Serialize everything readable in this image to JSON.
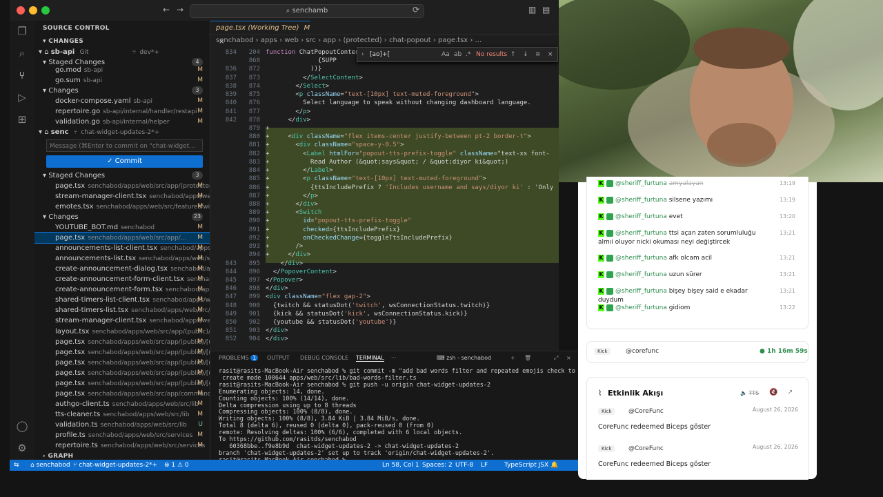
{
  "window": {
    "search": "senchamb"
  },
  "sidebar": {
    "title": "SOURCE CONTROL",
    "changes_header": "CHANGES",
    "repo1": {
      "name": "sb-api",
      "kind": "Git",
      "branch": "dev*+"
    },
    "staged1": {
      "label": "Staged Changes",
      "count": "4"
    },
    "staged1_items": [
      {
        "name": "go.mod",
        "path": "sb-api",
        "status": "M"
      },
      {
        "name": "go.sum",
        "path": "sb-api",
        "status": "M"
      }
    ],
    "changes1": {
      "label": "Changes",
      "count": "3"
    },
    "changes1_items": [
      {
        "name": "docker-compose.yaml",
        "path": "sb-api",
        "status": "M"
      },
      {
        "name": "repertoire.go",
        "path": "sb-api/internal/handler/restapi",
        "status": "M"
      },
      {
        "name": "validation.go",
        "path": "sb-api/internal/helper",
        "status": "M"
      }
    ],
    "repo2": {
      "name": "senc",
      "branch": "chat-widget-updates-2*+"
    },
    "message_placeholder": "Message (⌘Enter to commit on \"chat-widget...",
    "commit_label": "Commit",
    "staged2": {
      "label": "Staged Changes",
      "count": "3"
    },
    "staged2_items": [
      {
        "name": "page.tsx",
        "path": "senchabod/apps/web/src/app/(protected)...",
        "status": "M"
      },
      {
        "name": "stream-manager-client.tsx",
        "path": "senchabod/apps/web...",
        "status": "M"
      },
      {
        "name": "emotes.tsx",
        "path": "senchabod/apps/web/src/features/wid...",
        "status": "M"
      }
    ],
    "changes2": {
      "label": "Changes",
      "count": "23"
    },
    "changes2_items": [
      {
        "name": "YOUTUBE_BOT.md",
        "path": "senchabod",
        "status": "M"
      },
      {
        "name": "page.tsx",
        "path": "senchabod/apps/web/src/app/...",
        "status": "M"
      },
      {
        "name": "announcements-list-client.tsx",
        "path": "senchabod/apps/...",
        "status": "M"
      },
      {
        "name": "announcements-list.tsx",
        "path": "senchabod/apps/web/src...",
        "status": "M"
      },
      {
        "name": "create-announcement-dialog.tsx",
        "path": "senchabod/app...",
        "status": "M"
      },
      {
        "name": "create-announcement-form-client.tsx",
        "path": "senchab...",
        "status": "M"
      },
      {
        "name": "create-announcement-form.tsx",
        "path": "senchabod/apps...",
        "status": "M"
      },
      {
        "name": "shared-timers-list-client.tsx",
        "path": "senchabod/apps/we...",
        "status": "M"
      },
      {
        "name": "shared-timers-list.tsx",
        "path": "senchabod/apps/web/src/a...",
        "status": "M"
      },
      {
        "name": "stream-manager-client.tsx",
        "path": "senchabod/apps/web/sr...",
        "status": "M"
      },
      {
        "name": "layout.tsx",
        "path": "senchabod/apps/web/src/app/(public)/[...",
        "status": "M"
      },
      {
        "name": "page.tsx",
        "path": "senchabod/apps/web/src/app/(public)/[u...",
        "status": "M"
      },
      {
        "name": "page.tsx",
        "path": "senchabod/apps/web/src/app/(public)/[u...",
        "status": "M"
      },
      {
        "name": "page.tsx",
        "path": "senchabod/apps/web/src/app/(public)/[u...",
        "status": "M"
      },
      {
        "name": "page.tsx",
        "path": "senchabod/apps/web/src/app/(public)/[u...",
        "status": "M"
      },
      {
        "name": "page.tsx",
        "path": "senchabod/apps/web/src/app/(public)/[u...",
        "status": "M"
      },
      {
        "name": "page.tsx",
        "path": "senchabod/apps/web/src/app/commands...",
        "status": "M"
      },
      {
        "name": "authgo-client.ts",
        "path": "senchabod/apps/web/src/lib",
        "status": "M"
      },
      {
        "name": "tts-cleaner.ts",
        "path": "senchabod/apps/web/src/lib",
        "status": "M"
      },
      {
        "name": "validation.ts",
        "path": "senchabod/apps/web/src/lib",
        "status": "U"
      },
      {
        "name": "profile.ts",
        "path": "senchabod/apps/web/src/services",
        "status": "M"
      },
      {
        "name": "repertoire.ts",
        "path": "senchabod/apps/web/src/services",
        "status": "M"
      }
    ],
    "graph": "GRAPH"
  },
  "editor": {
    "tab": "page.tsx (Working Tree)",
    "tab_status": "M",
    "breadcrumb": [
      "senchabod",
      "apps",
      "web",
      "src",
      "app",
      "(protected)",
      "chat-popout",
      "page.tsx",
      "..."
    ],
    "find": {
      "query": "[ao]+[",
      "result": "No results"
    },
    "lines": [
      [
        "834",
        "204",
        "function ChatPopoutContent("
      ],
      [
        "",
        "868",
        "              {SUPP"
      ],
      [
        "836",
        "872",
        "            ))}"
      ],
      [
        "837",
        "873",
        "          </SelectContent>"
      ],
      [
        "838",
        "874",
        "        </Select>"
      ],
      [
        "839",
        "875",
        "        <p className=\"text-[10px] text-muted-foreground\">"
      ],
      [
        "840",
        "876",
        "          Select language to speak without changing dashboard language."
      ],
      [
        "841",
        "877",
        "        </p>"
      ],
      [
        "842",
        "878",
        "      </div>"
      ],
      [
        "",
        "879",
        "+"
      ],
      [
        "",
        "880",
        "+     <div className=\"flex items-center justify-between pt-2 border-t\">"
      ],
      [
        "",
        "881",
        "+       <div className=\"space-y-0.5\">"
      ],
      [
        "",
        "882",
        "+         <Label htmlFor=\"popout-tts-prefix-toggle\" className=\"text-xs font-"
      ],
      [
        "",
        "883",
        "+           Read Author (&quot;says&quot; / &quot;diyor ki&quot;)"
      ],
      [
        "",
        "884",
        "+         </Label>"
      ],
      [
        "",
        "885",
        "+         <p className=\"text-[10px] text-muted-foreground\">"
      ],
      [
        "",
        "886",
        "+           {ttsIncludePrefix ? 'Includes username and says/diyor ki' : 'Only"
      ],
      [
        "",
        "887",
        "+         </p>"
      ],
      [
        "",
        "888",
        "+       </div>"
      ],
      [
        "",
        "889",
        "+       <Switch"
      ],
      [
        "",
        "890",
        "+         id=\"popout-tts-prefix-toggle\""
      ],
      [
        "",
        "891",
        "+         checked={ttsIncludePrefix}"
      ],
      [
        "",
        "892",
        "+         onCheckedChange={toggleTtsIncludePrefix}"
      ],
      [
        "",
        "893",
        "+       />"
      ],
      [
        "",
        "894",
        "+     </div>"
      ],
      [
        "843",
        "895",
        "    </div>"
      ],
      [
        "844",
        "896",
        "  </PopoverContent>"
      ],
      [
        "845",
        "897",
        "</Popover>"
      ],
      [
        "846",
        "898",
        "</div>"
      ],
      [
        "847",
        "899",
        "<div className=\"flex gap-2\">"
      ],
      [
        "848",
        "900",
        "  {twitch && statusDot('twitch', wsConnectionStatus.twitch)}"
      ],
      [
        "849",
        "901",
        "  {kick && statusDot('kick', wsConnectionStatus.kick)}"
      ],
      [
        "850",
        "902",
        "  {youtube && statusDot('youtube')}"
      ],
      [
        "851",
        "903",
        "</div>"
      ],
      [
        "852",
        "904",
        "</div>"
      ]
    ]
  },
  "panel": {
    "tabs": [
      "PROBLEMS",
      "OUTPUT",
      "DEBUG CONSOLE",
      "TERMINAL",
      "···"
    ],
    "problems_count": "1",
    "shell": "zsh - senchabod",
    "terminal": [
      "rasit@rasits-MacBook-Air senchabod % git commit -m \"add bad words filter and repeated emojis check to tts\"",
      " create mode 100644 apps/web/src/lib/bad-words-filter.ts",
      "rasit@rasits-MacBook-Air senchabod % git push -u origin chat-widget-updates-2",
      "Enumerating objects: 14, done.",
      "Counting objects: 100% (14/14), done.",
      "Delta compression using up to 8 threads",
      "Compressing objects: 100% (8/8), done.",
      "Writing objects: 100% (8/8), 3.84 KiB | 3.84 MiB/s, done.",
      "Total 8 (delta 6), reused 0 (delta 0), pack-reused 0 (from 0)",
      "remote: Resolving deltas: 100% (6/6), completed with 6 local objects.",
      "To https://github.com/rasitds/senchabod",
      "   60368bbe..f9e8b9d  chat-widget-updates-2 -> chat-widget-updates-2",
      "branch 'chat-widget-updates-2' set up to track 'origin/chat-widget-updates-2'.",
      "rasit@rasits-MacBook-Air senchabod % "
    ]
  },
  "statusbar": {
    "repo": "senchabod",
    "branch": "chat-widget-updates-2*+",
    "problems": "⊗ 1 ⚠ 0",
    "position": "Ln 58, Col 1",
    "spaces": "Spaces: 2",
    "encoding": "UTF-8",
    "eol": "LF",
    "language": "TypeScript JSX"
  },
  "chat": {
    "messages": [
      {
        "user": "@sheriff_furtuna",
        "text": "amyalayan",
        "time": "13:19"
      },
      {
        "user": "@sheriff_furtuna",
        "text": "silsene yazımı",
        "time": "13:19"
      },
      {
        "user": "@sheriff_furtuna",
        "text": "evet",
        "time": "13:20"
      },
      {
        "user": "@sheriff_furtuna",
        "text": "ttsi açan zaten sorumluluğu almıi oluyor nicki okuması neyi değiştircek",
        "time": "13:21"
      },
      {
        "user": "@sheriff_furtuna",
        "text": "afk olcam acil",
        "time": "13:21"
      },
      {
        "user": "@sheriff_furtuna",
        "text": "uzun sürer",
        "time": "13:21"
      },
      {
        "user": "@sheriff_furtuna",
        "text": "bişey bişey said e ekadar duydum",
        "time": "13:21"
      },
      {
        "user": "@sheriff_furtuna",
        "text": "gidiom",
        "time": "13:22"
      }
    ],
    "kick_label": "Kick",
    "kick_user": "@corefunc",
    "uptime": "1h 16m 59s",
    "activity": {
      "title": "Etkinlik Akışı",
      "tts_label": "TTS",
      "events": [
        {
          "platform": "Kick",
          "user": "@CoreFunc",
          "date": "August 26, 2026",
          "text": "CoreFunc redeemed Biceps göster"
        },
        {
          "platform": "Kick",
          "user": "@CoreFunc",
          "date": "August 26, 2026",
          "text": "CoreFunc redeemed Biceps göster"
        }
      ]
    }
  }
}
